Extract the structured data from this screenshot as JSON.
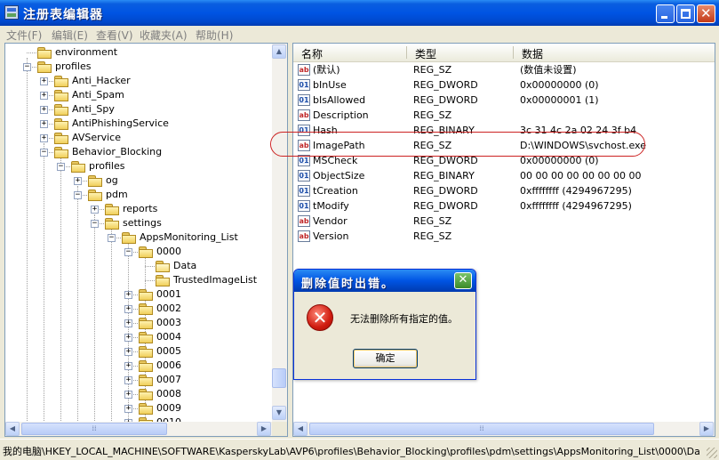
{
  "window": {
    "title": "注册表编辑器"
  },
  "menu": [
    "文件(F)",
    "编辑(E)",
    "查看(V)",
    "收藏夹(A)",
    "帮助(H)"
  ],
  "tree": {
    "nodes": [
      {
        "label": "environment",
        "level": 1,
        "expander": ""
      },
      {
        "label": "profiles",
        "level": 1,
        "expander": "-"
      },
      {
        "label": "Anti_Hacker",
        "level": 2,
        "expander": "+"
      },
      {
        "label": "Anti_Spam",
        "level": 2,
        "expander": "+"
      },
      {
        "label": "Anti_Spy",
        "level": 2,
        "expander": "+"
      },
      {
        "label": "AntiPhishingService",
        "level": 2,
        "expander": "+"
      },
      {
        "label": "AVService",
        "level": 2,
        "expander": "+"
      },
      {
        "label": "Behavior_Blocking",
        "level": 2,
        "expander": "-"
      },
      {
        "label": "profiles",
        "level": 3,
        "expander": "-"
      },
      {
        "label": "og",
        "level": 4,
        "expander": "+"
      },
      {
        "label": "pdm",
        "level": 4,
        "expander": "-"
      },
      {
        "label": "reports",
        "level": 5,
        "expander": "+"
      },
      {
        "label": "settings",
        "level": 5,
        "expander": "-"
      },
      {
        "label": "AppsMonitoring_List",
        "level": 6,
        "expander": "-"
      },
      {
        "label": "0000",
        "level": 7,
        "expander": "-"
      },
      {
        "label": "Data",
        "level": 8,
        "expander": "",
        "open": true
      },
      {
        "label": "TrustedImageList",
        "level": 8,
        "expander": ""
      },
      {
        "label": "0001",
        "level": 7,
        "expander": "+"
      },
      {
        "label": "0002",
        "level": 7,
        "expander": "+"
      },
      {
        "label": "0003",
        "level": 7,
        "expander": "+"
      },
      {
        "label": "0004",
        "level": 7,
        "expander": "+"
      },
      {
        "label": "0005",
        "level": 7,
        "expander": "+"
      },
      {
        "label": "0006",
        "level": 7,
        "expander": "+"
      },
      {
        "label": "0007",
        "level": 7,
        "expander": "+"
      },
      {
        "label": "0008",
        "level": 7,
        "expander": "+"
      },
      {
        "label": "0009",
        "level": 7,
        "expander": "+"
      },
      {
        "label": "0010",
        "level": 7,
        "expander": "+"
      }
    ]
  },
  "list": {
    "columns": [
      "名称",
      "类型",
      "数据"
    ],
    "rows": [
      {
        "icon": "string-value-icon",
        "name": "(默认)",
        "type": "REG_SZ",
        "data": "(数值未设置)"
      },
      {
        "icon": "binary-value-icon",
        "name": "bInUse",
        "type": "REG_DWORD",
        "data": "0x00000000 (0)"
      },
      {
        "icon": "binary-value-icon",
        "name": "bIsAllowed",
        "type": "REG_DWORD",
        "data": "0x00000001 (1)"
      },
      {
        "icon": "string-value-icon",
        "name": "Description",
        "type": "REG_SZ",
        "data": ""
      },
      {
        "icon": "binary-value-icon",
        "name": "Hash",
        "type": "REG_BINARY",
        "data": "3c 31 4c 2a 02 24 3f b4"
      },
      {
        "icon": "string-value-icon",
        "name": "ImagePath",
        "type": "REG_SZ",
        "data": "D:\\WINDOWS\\svchost.exe"
      },
      {
        "icon": "binary-value-icon",
        "name": "MSCheck",
        "type": "REG_DWORD",
        "data": "0x00000000 (0)"
      },
      {
        "icon": "binary-value-icon",
        "name": "ObjectSize",
        "type": "REG_BINARY",
        "data": "00 00 00 00 00 00 00 00"
      },
      {
        "icon": "binary-value-icon",
        "name": "tCreation",
        "type": "REG_DWORD",
        "data": "0xffffffff (4294967295)"
      },
      {
        "icon": "binary-value-icon",
        "name": "tModify",
        "type": "REG_DWORD",
        "data": "0xffffffff (4294967295)"
      },
      {
        "icon": "string-value-icon",
        "name": "Vendor",
        "type": "REG_SZ",
        "data": ""
      },
      {
        "icon": "string-value-icon",
        "name": "Version",
        "type": "REG_SZ",
        "data": ""
      }
    ]
  },
  "dialog": {
    "title": "删除值时出错。",
    "message": "无法删除所有指定的值。",
    "ok_label": "确定",
    "icon": "error-icon"
  },
  "status": {
    "path": "我的电脑\\HKEY_LOCAL_MACHINE\\SOFTWARE\\KasperskyLab\\AVP6\\profiles\\Behavior_Blocking\\profiles\\pdm\\settings\\AppsMonitoring_List\\0000\\Da"
  },
  "colors": {
    "title_bar": "#0054e3",
    "highlight_outline": "#cc2222"
  }
}
